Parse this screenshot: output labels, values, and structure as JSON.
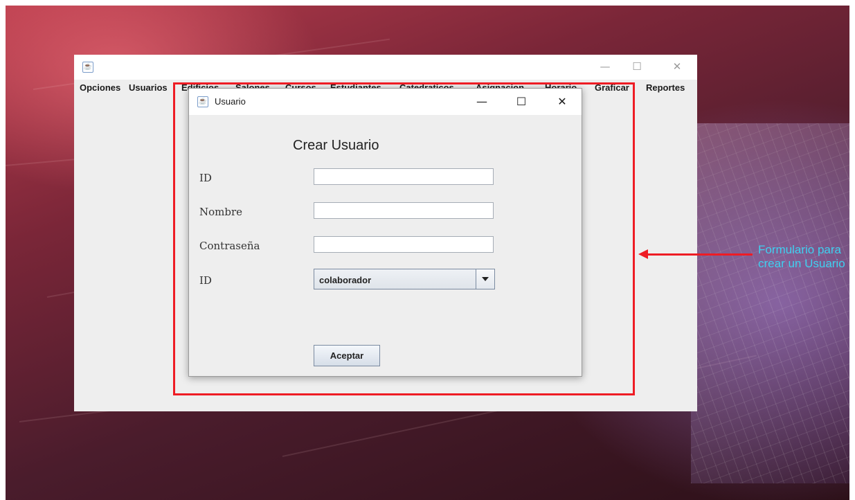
{
  "main_window": {
    "title": "",
    "menu": [
      "Opciones",
      "Usuarios",
      "Edificios",
      "Salones",
      "Cursos",
      "Estudiantes",
      "Catedraticos",
      "Asignacion",
      "Horario",
      "Graficar",
      "Reportes"
    ],
    "controls": {
      "minimize": "—",
      "maximize": "☐",
      "close": "✕"
    }
  },
  "dialog": {
    "title": "Usuario",
    "controls": {
      "minimize": "—",
      "maximize": "☐",
      "close": "✕"
    },
    "heading": "Crear Usuario",
    "fields": [
      {
        "label": "ID",
        "value": ""
      },
      {
        "label": "Nombre",
        "value": ""
      },
      {
        "label": "Contraseña",
        "value": ""
      }
    ],
    "select": {
      "label": "ID",
      "value": "colaborador"
    },
    "accept_label": "Aceptar"
  },
  "annotation": {
    "text": "Formulario para crear un Usuario",
    "color": "#ee1c24",
    "text_color": "#3fd0f0"
  },
  "icons": {
    "app": "java-coffee-icon",
    "dropdown": "chevron-down-icon"
  }
}
